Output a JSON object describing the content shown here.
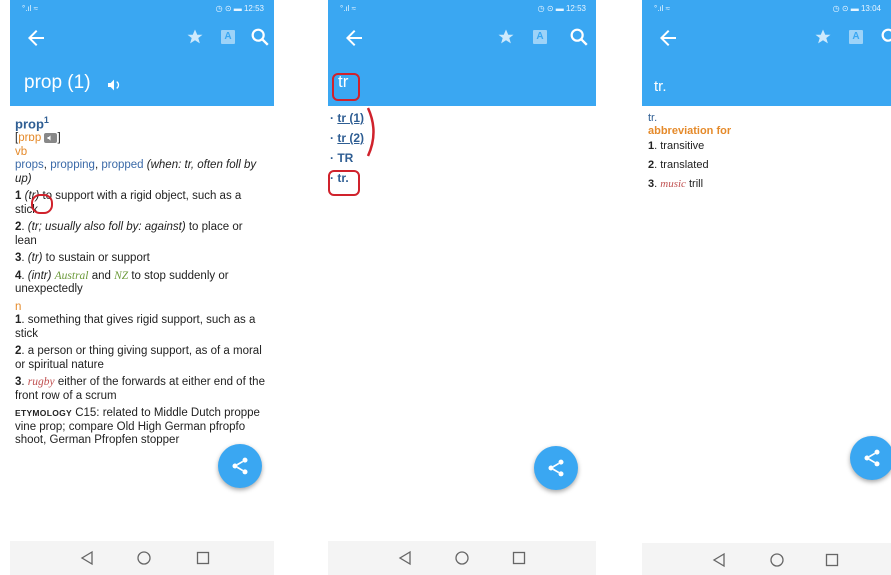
{
  "status": {
    "signal": "°.ıl ≈",
    "p1_right": "◷ ⊙ ▬ 12:53",
    "p2_right": "◷ ⊙ ▬ 12:53",
    "p3_right": "◷ ⊙ ▬ 13:04"
  },
  "panel1": {
    "title": "prop (1)",
    "headword": "prop",
    "headword_sup": "1",
    "pron_open": "[",
    "pron": "prɒp",
    "pron_close": "]",
    "pos_verb": "vb",
    "forms_a": "props",
    "forms_b": "propping",
    "forms_c": "propped",
    "forms_note": "(when: tr, often foll by up)",
    "sep": ",",
    "defs_vb": [
      {
        "num": "1",
        "label": "(tr)",
        "text": " to support with a rigid object, such as a stick"
      },
      {
        "num": "2",
        "label": "(tr; usually also foll by: against)",
        "text": " to place or lean"
      },
      {
        "num": "3",
        "label": "(tr)",
        "text": " to sustain or support"
      },
      {
        "num": "4",
        "label": "(intr)",
        "region1": "Austral",
        "and": " and ",
        "region2": "NZ",
        "text": " to stop suddenly or unexpectedly"
      }
    ],
    "pos_noun": "n",
    "defs_n": [
      {
        "num": "1",
        "text": "something that gives rigid support, such as a stick"
      },
      {
        "num": "2",
        "text": "a person or thing giving support, as of a moral or spiritual nature"
      },
      {
        "num": "3",
        "field": "rugby",
        "text": " either of the forwards at either end of the front row of a scrum"
      }
    ],
    "etym_label": "ETYMOLOGY",
    "etym_text": " C15: related to Middle Dutch proppe vine prop; compare Old High German pfropfo shoot, German Pfropfen stopper"
  },
  "panel2": {
    "title": "tr",
    "items": [
      "tr (1)",
      "tr (2)",
      "TR",
      "tr."
    ]
  },
  "panel3": {
    "title": "tr.",
    "headword": "tr.",
    "label": "abbreviation for",
    "defs": [
      {
        "num": "1",
        "text": "transitive"
      },
      {
        "num": "2",
        "text": "translated"
      },
      {
        "num": "3",
        "field": "music",
        "text": " trill"
      }
    ]
  },
  "colors": {
    "appbar": "#3aa7f2",
    "accent_orange": "#e58a2a",
    "mark_red": "#d0222c"
  }
}
